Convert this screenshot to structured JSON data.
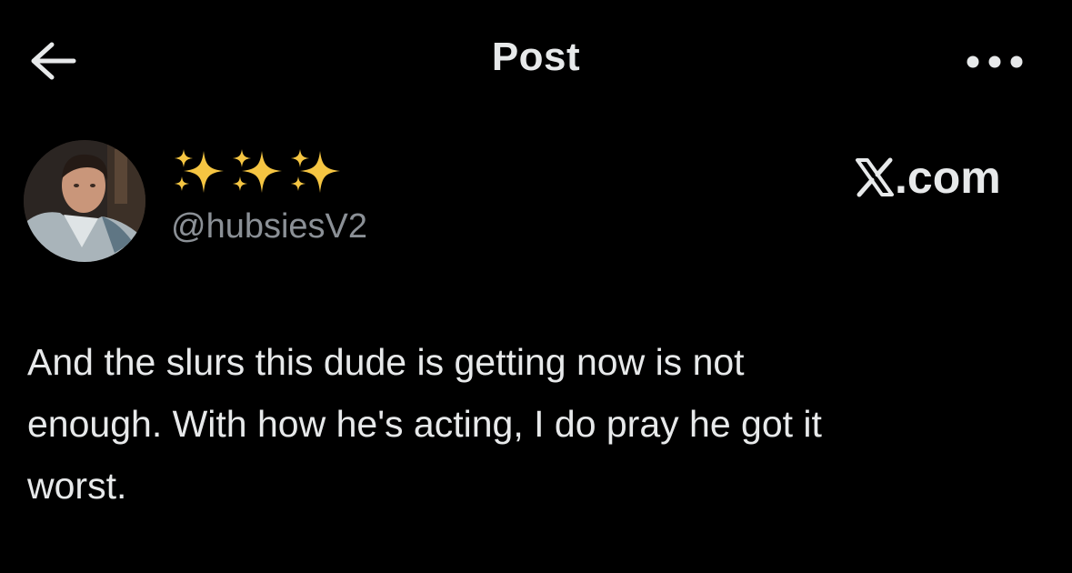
{
  "header": {
    "back_icon": "arrow-left-icon",
    "title": "Post",
    "more_icon": "more-horizontal-icon"
  },
  "author": {
    "avatar_icon": "avatar-photo",
    "display_name": "✨✨✨",
    "handle": "@hubsiesV2",
    "site_tag": "𝕏.com"
  },
  "tweet": {
    "lines": [
      "And the slurs this dude is getting now is not",
      "enough. With how he's acting, I do pray he got it",
      "worst."
    ]
  },
  "colors": {
    "background": "#000000",
    "text_primary": "#e7e9ea",
    "text_secondary": "#8b9096",
    "sparkle": "#f5c542"
  }
}
